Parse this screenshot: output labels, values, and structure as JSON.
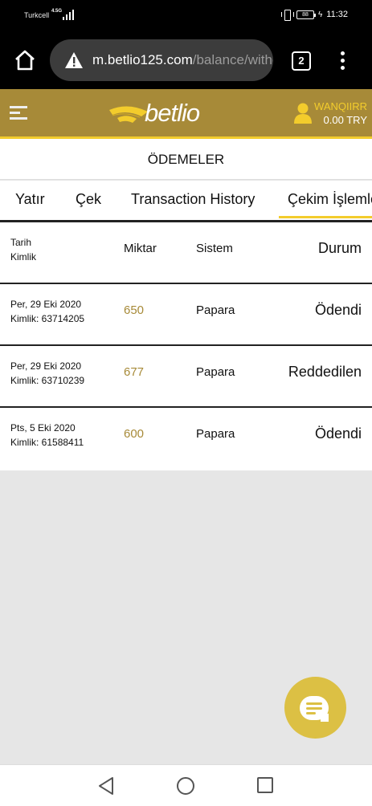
{
  "status_bar": {
    "carrier": "Turkcell",
    "network": "4.5G",
    "battery": "88",
    "time": "11:32"
  },
  "browser": {
    "url_domain": "m.betlio125.com",
    "url_path": "/balance/withc",
    "tab_count": "2"
  },
  "header": {
    "logo_text": "betlio",
    "username": "WANQIIRR",
    "balance": "0.00 TRY"
  },
  "page": {
    "title": "ÖDEMELER"
  },
  "tabs": [
    {
      "label": "Yatır"
    },
    {
      "label": "Çek"
    },
    {
      "label": "Transaction History"
    },
    {
      "label": "Çekim İşlemle",
      "active": true
    }
  ],
  "table": {
    "headers": {
      "date": "Tarih",
      "id": "Kimlik",
      "amount": "Miktar",
      "system": "Sistem",
      "status": "Durum"
    },
    "rows": [
      {
        "date": "Per, 29 Eki 2020",
        "id": "Kimlik: 63714205",
        "amount": "650",
        "system": "Papara",
        "status": "Ödendi"
      },
      {
        "date": "Per, 29 Eki 2020",
        "id": "Kimlik: 63710239",
        "amount": "677",
        "system": "Papara",
        "status": "Reddedilen"
      },
      {
        "date": "Pts, 5 Eki 2020",
        "id": "Kimlik: 61588411",
        "amount": "600",
        "system": "Papara",
        "status": "Ödendi"
      }
    ]
  },
  "colors": {
    "brand_gold": "#a78a38",
    "accent_yellow": "#f3cc2c",
    "chat_button": "#dcc044"
  },
  "icons": {
    "browser_home": "home-icon",
    "security": "warning-icon",
    "menu": "hamburger-icon",
    "user": "user-icon",
    "chat": "chat-icon"
  }
}
